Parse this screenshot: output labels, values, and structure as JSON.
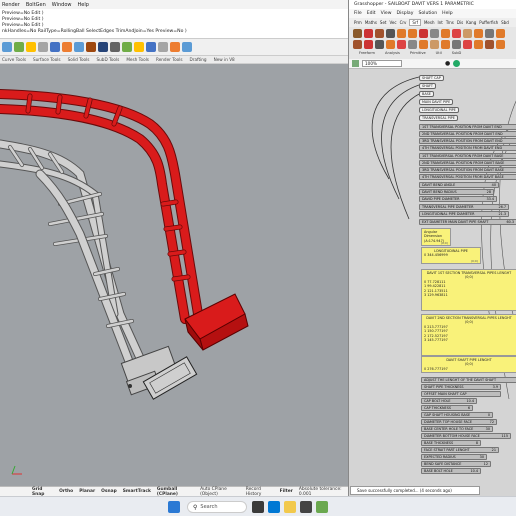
{
  "rhino": {
    "menu": [
      "Render",
      "BoltGen",
      "Window",
      "Help"
    ],
    "command_lines": [
      "Preview=No  Edit )",
      "Preview=No  Edit )",
      "Preview=No  Edit )",
      "nkHandles=No  RailType=RollingBall  SelectEdges  TrimAndJoin=Yes  Preview=No )"
    ],
    "tabs": [
      "Curve Tools",
      "Surface Tools",
      "Solid Tools",
      "SubD Tools",
      "Mesh Tools",
      "Render Tools",
      "Drafting",
      "New in V8"
    ],
    "status": {
      "grid_snap": "Grid Snap",
      "ortho": "Ortho",
      "planar": "Planar",
      "osnap": "Osnap",
      "smarttrack": "SmartTrack",
      "gumball": "Gumball (CPlane)",
      "auto_cplane": "Auto CPlane (Object)",
      "record_history": "Record History",
      "filter": "Filter",
      "tolerance": "Absolute tolerance: 0.001"
    }
  },
  "gh": {
    "title": "Grasshopper - SAILBOAT DAVIT VERS 1 PARAMETRIC",
    "menu": [
      "File",
      "Edit",
      "View",
      "Display",
      "Solution",
      "Help"
    ],
    "tabs": [
      "Prm",
      "Maths",
      "Set",
      "Vec",
      "Crv",
      "Srf",
      "Mesh",
      "Int",
      "Trns",
      "Dis",
      "Kang",
      "Pufferfish",
      "Sbd"
    ],
    "active_tab": "Srf",
    "panel_groups": [
      "Freeform",
      "Analysis",
      "Primitive",
      "Util",
      "SubD"
    ],
    "zoom": "100%",
    "tags": [
      "SHAFT CAP",
      "SHAFT",
      "BASE",
      "MAIN DAVIT PIPE",
      "LONGITUDINAL PIPE",
      "TRANSVERSAL PIPE"
    ],
    "sliders": [
      {
        "label": "1ST TRANSVERSAL POSITION FROM DAVIT END",
        "value": ""
      },
      {
        "label": "2ND TRANSVERSAL POSITION FROM DAVIT END",
        "value": ""
      },
      {
        "label": "3RD TRANSVERSAL POSITION FROM DAVIT END",
        "value": ""
      },
      {
        "label": "4TH TRANSVERSAL POSITION FROM DAVIT END",
        "value": ""
      },
      {
        "label": "1ST TRANSVERSAL POSITION FROM DAVIT BASE",
        "value": ""
      },
      {
        "label": "2ND TRANSVERSAL POSITION FROM DAVIT BASE",
        "value": ""
      },
      {
        "label": "3RD TRANSVERSAL POSITION FROM DAVIT BASE",
        "value": ""
      },
      {
        "label": "4TH TRANSVERSAL POSITION FROM DAVIT BASE",
        "value": ""
      },
      {
        "label": "DAVIT BEND ANGLE",
        "value": "40"
      },
      {
        "label": "DAVIT BEND RADIUS",
        "value": "28"
      },
      {
        "label": "DAVID PIPE DIAMETER",
        "value": "33.4"
      },
      {
        "label": "TRANSVERSAL PIPE DIAMETER",
        "value": "26.7"
      },
      {
        "label": "LONGITUDINAL PIPE DIAMETER",
        "value": "21.3"
      },
      {
        "label": "EXT DIAMETER MAIN DAVIT PIPE SHAFT",
        "value": "60.3"
      }
    ],
    "panel_angular": {
      "lines": [
        "Angular",
        "Dimension",
        "(A:174.947)"
      ],
      "footer": "(0;0)"
    },
    "panel_long_pipe": {
      "header": "LONGITUDINAL PIPE",
      "footer": "(0;0)",
      "value": "0 344.456999"
    },
    "panel_section1": {
      "header": "DAVIT 1ST SECTION TRANSVERSAL PIPES LENGHT",
      "footer": "(0;0)",
      "values": [
        "0 77.728111",
        "1 99.422811",
        "2 121.173511",
        "3 129.963811"
      ]
    },
    "panel_section2": {
      "header": "DAVIT 2ND SECTION TRANSVERSAL PIPES LENGHT",
      "footer": "(0;0)",
      "values": [
        "0 213.777197",
        "1 150.777197",
        "2 172.527197",
        "3 145.777197"
      ]
    },
    "panel_shaft": {
      "header": "DAVIT SHAFT PIPE LENGHT",
      "footer": "(0;0)",
      "value": "0 276.777197"
    },
    "sliders_lower": [
      {
        "label": "ADJUST THE LENGHT OF THE DAVIT SHAFT",
        "value": ""
      },
      {
        "label": "SHAFT PIPE THICKNESS",
        "value": "3.9"
      },
      {
        "label": "OFFSET MAIN SHAFT CAP",
        "value": ""
      },
      {
        "label": "CAP BOLT HOLE",
        "value": "10.4"
      },
      {
        "label": "CAP THICKNESS",
        "value": "6"
      },
      {
        "label": "GAP SHAFT HOUSING BASE",
        "value": "0"
      },
      {
        "label": "DIAMETER TOP HOUSE FACE",
        "value": "72"
      },
      {
        "label": "BASE CENTER HOLE TO FACE",
        "value": "30"
      },
      {
        "label": "DIAMETER BOTTOM HOUSE FACE",
        "value": "115"
      },
      {
        "label": "BASE THICKNESS",
        "value": "8"
      },
      {
        "label": "FACE STRAIT PART LENGHT",
        "value": "21"
      },
      {
        "label": "EXPECTED RADIUS",
        "value": "30"
      },
      {
        "label": "BEND SAFE DISTANCE",
        "value": "12"
      },
      {
        "label": "BASE BOLT HOLE",
        "value": "10.4"
      }
    ],
    "notification": "Save successfully completed...  (4 seconds ago)"
  },
  "taskbar": {
    "search_placeholder": "Search"
  },
  "colors": {
    "davit_red": "#d91b1b",
    "davit_grey": "#c9c9c9",
    "viewport_bg": "#9ea2a6",
    "gh_canvas": "#d4d4d4",
    "panel_yellow": "#f9f27a"
  }
}
